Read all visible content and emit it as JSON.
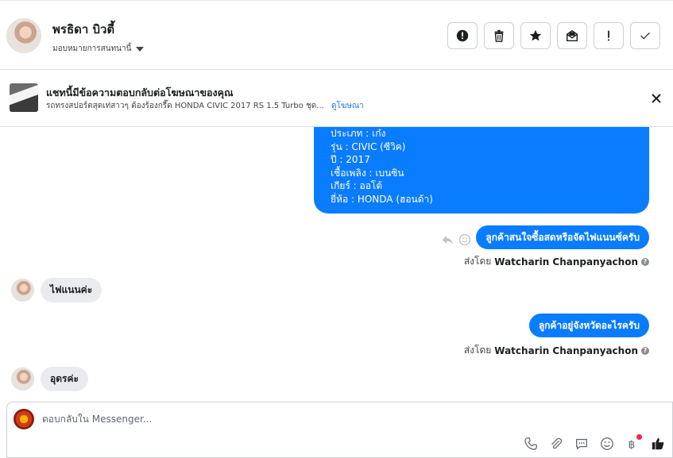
{
  "header": {
    "contact_name": "พรธิดา บิวตี้",
    "assign_label": "มอบหมายการสนทนานี้"
  },
  "ad_reply": {
    "title": "แชทนี้มีข้อความตอบกลับต่อโฆษณาของคุณ",
    "subtitle": "รถทรงสปอร์ตสุดเท่สาวๆ ต้องร้องกรี๊ด HONDA CIVIC 2017 RS 1.5 Turbo ชุด...",
    "link": "ดูโฆษณา"
  },
  "messages": {
    "car_details": [
      "ประเภท : เก๋ง",
      "รุ่น : CIVIC (ซีวิค)",
      "ปี : 2017",
      "เชื้อเพลิง : เบนซิน",
      "เกียร์ : ออโต้",
      "ยี่ห้อ : HONDA (ฮอนด้า)"
    ],
    "out_1": "ลูกค้าสนใจซื้อสดหรือจัดไฟแนนซ์ครับ",
    "sent_by_prefix": "ส่งโดย",
    "agent_name": "Watcharin Chanpanyachon",
    "in_1": "ไฟแนนค่ะ",
    "out_2": "ลูกค้าอยู่จังหวัดอะไรครับ",
    "in_2": "อุดรค่ะ"
  },
  "composer": {
    "placeholder": "ตอบกลับใน Messenger...",
    "tools": [
      "phone-icon",
      "paperclip-icon",
      "chat-bubble-icon",
      "emoji-icon",
      "baht-icon",
      "thumbs-up-icon"
    ]
  },
  "colors": {
    "accent": "#0a7cff",
    "incoming_bubble": "#e9ebee",
    "link": "#1877f2",
    "notification_dot": "#f02849"
  }
}
